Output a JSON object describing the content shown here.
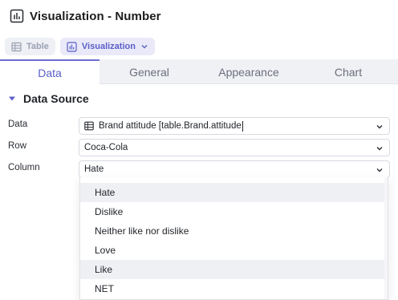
{
  "window": {
    "title": "Visualization - Number"
  },
  "toolbar": {
    "table_label": "Table",
    "visualization_label": "Visualization"
  },
  "tabs": [
    {
      "label": "Data",
      "active": true
    },
    {
      "label": "General",
      "active": false
    },
    {
      "label": "Appearance",
      "active": false
    },
    {
      "label": "Chart",
      "active": false
    }
  ],
  "section": {
    "title": "Data Source"
  },
  "fields": {
    "data": {
      "label": "Data",
      "value": "Brand attitude [table.Brand.attitude"
    },
    "row": {
      "label": "Row",
      "value": "Coca-Cola"
    },
    "column": {
      "label": "Column",
      "value": "Hate"
    }
  },
  "dropdown": {
    "options": [
      {
        "label": "Hate",
        "highlighted": true
      },
      {
        "label": "Dislike",
        "highlighted": false
      },
      {
        "label": "Neither like nor dislike",
        "highlighted": false
      },
      {
        "label": "Love",
        "highlighted": false
      },
      {
        "label": "Like",
        "highlighted": true
      },
      {
        "label": "NET",
        "highlighted": false
      }
    ]
  },
  "colors": {
    "accent": "#5a5fc6",
    "tab_bar": "#f0f1f5",
    "highlight": "#eff0f4"
  },
  "icons": {
    "title": "bar-chart-icon",
    "table": "table-grid-icon",
    "visualization": "bar-chart-icon",
    "dropdown": "chevron-down-icon",
    "section": "caret-down-icon"
  }
}
